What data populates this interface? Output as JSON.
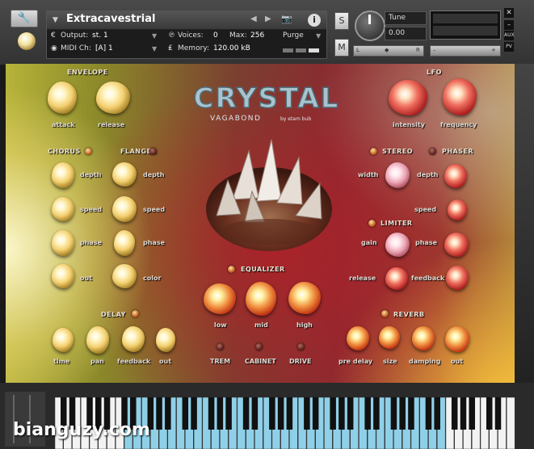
{
  "instrument": {
    "name": "Extracavestrial",
    "output_label": "Output:",
    "output_value": "st. 1",
    "voices_label": "Voices:",
    "voices_value": "0",
    "max_label": "Max:",
    "max_value": "256",
    "purge_label": "Purge",
    "midi_label": "MIDI Ch:",
    "midi_value": "[A]  1",
    "memory_label": "Memory:",
    "memory_value": "120.00 kB",
    "solo_label": "S",
    "mute_label": "M",
    "tune_label": "Tune",
    "tune_value": "0.00",
    "pan_left": "L",
    "pan_right": "R",
    "aux_label": "AUX",
    "pv_label": "PV"
  },
  "logo": {
    "title": "CRYSTAL",
    "brand": "VAGABOND",
    "byline": "by  etam  bub"
  },
  "envelope": {
    "title": "ENVELOPE",
    "attack": "attack",
    "release": "release"
  },
  "lfo": {
    "title": "LFO",
    "intensity": "intensity",
    "frequency": "frequency"
  },
  "chorus": {
    "title": "CHORUS",
    "depth": "depth",
    "speed": "speed",
    "phase": "phase",
    "out": "out"
  },
  "flanger": {
    "title": "FLANGER",
    "depth": "depth",
    "speed": "speed",
    "phase": "phase",
    "color": "color"
  },
  "stereo": {
    "title": "STEREO",
    "width": "width"
  },
  "phaser": {
    "title": "PHASER",
    "depth": "depth",
    "speed": "speed"
  },
  "limiter": {
    "title": "LIMITER",
    "gain": "gain",
    "phase": "phase",
    "release": "release",
    "feedback": "feedback"
  },
  "equalizer": {
    "title": "EQUALIZER",
    "low": "low",
    "mid": "mid",
    "high": "high"
  },
  "delay": {
    "title": "DELAY",
    "time": "time",
    "pan": "pan",
    "feedback": "feedback",
    "out": "out"
  },
  "reverb": {
    "title": "REVERB",
    "pre_delay": "pre delay",
    "size": "size",
    "damping": "damping",
    "out": "out"
  },
  "toggles": {
    "trem": "TREM",
    "cabinet": "CABINET",
    "drive": "DRIVE"
  },
  "watermark": "bianguzy.com",
  "colors": {
    "header": "#3a3a3a",
    "key_highlight": "#8fd0e8",
    "label": "#e0d8d0"
  }
}
